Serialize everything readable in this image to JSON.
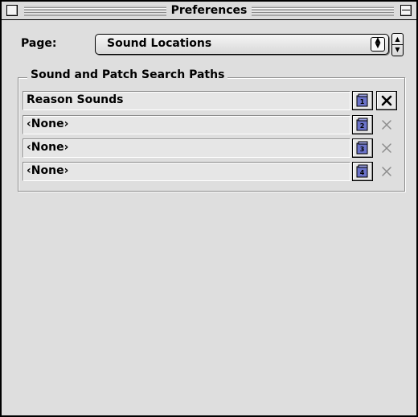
{
  "window": {
    "title": "Preferences"
  },
  "page": {
    "label": "Page:",
    "selected": "Sound Locations"
  },
  "group": {
    "title": "Sound and Patch Search Paths"
  },
  "paths": [
    {
      "label": "Reason Sounds",
      "slot": "1",
      "clear_enabled": true
    },
    {
      "label": "‹None›",
      "slot": "2",
      "clear_enabled": false
    },
    {
      "label": "‹None›",
      "slot": "3",
      "clear_enabled": false
    },
    {
      "label": "‹None›",
      "slot": "4",
      "clear_enabled": false
    }
  ],
  "icons": {
    "close": "close-box-icon",
    "collapse": "collapse-box-icon",
    "folder": "folder-browse-icon",
    "clear": "x-clear-icon",
    "popup_arrows": "popup-arrows-icon",
    "stepper": "stepper-arrows-icon"
  },
  "colors": {
    "window_bg": "#dedede",
    "folder_icon": "#6b73c9"
  }
}
